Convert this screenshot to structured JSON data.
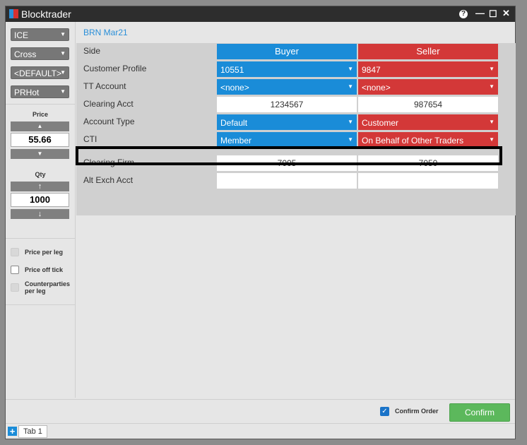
{
  "app": {
    "title": "Blocktrader",
    "help": "?"
  },
  "sidebar": {
    "dropdowns": [
      "ICE",
      "Cross",
      "<DEFAULT>",
      "PRHot"
    ],
    "price": {
      "label": "Price",
      "value": "55.66"
    },
    "qty": {
      "label": "Qty",
      "value": "1000"
    },
    "checkboxes": [
      {
        "label": "Price per leg",
        "checked": false,
        "enabled": false
      },
      {
        "label": "Price off tick",
        "checked": false,
        "enabled": true
      },
      {
        "label": "Counterparties per leg",
        "checked": false,
        "enabled": false
      }
    ]
  },
  "main": {
    "instrument": "BRN Mar21",
    "rows": [
      {
        "label": "Side",
        "buyer": "Buyer",
        "seller": "Seller"
      },
      {
        "label": "Customer Profile",
        "buyer": "10551",
        "seller": "9847"
      },
      {
        "label": "TT Account",
        "buyer": "<none>",
        "seller": "<none>"
      },
      {
        "label": "Clearing Acct",
        "buyer": "1234567",
        "seller": "987654"
      },
      {
        "label": "Account Type",
        "buyer": "Default",
        "seller": "Customer"
      },
      {
        "label": "CTI",
        "buyer": "Member",
        "seller": "On Behalf of Other Traders"
      },
      {
        "label": "Clearing Firm",
        "buyer": "7005",
        "seller": "7050"
      },
      {
        "label": "Alt Exch Acct",
        "buyer": "",
        "seller": ""
      }
    ]
  },
  "footer": {
    "confirm_order_label": "Confirm Order",
    "confirm_order_checked": true,
    "confirm_button": "Confirm",
    "tab_label": "Tab 1"
  },
  "colors": {
    "buyer": "#1a8cd8",
    "seller": "#d33838",
    "confirm": "#5cb85c"
  }
}
